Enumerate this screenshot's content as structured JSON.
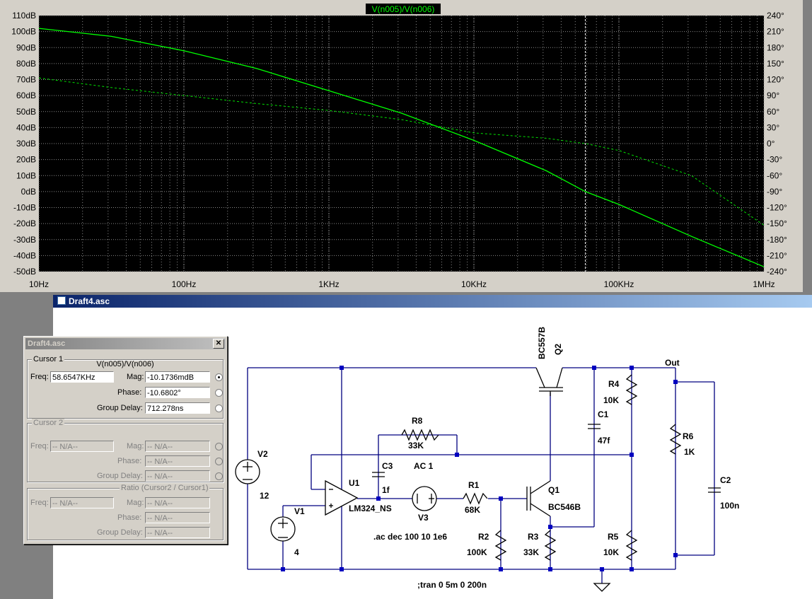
{
  "plot": {
    "trace_title": "V(n005)/V(n006)",
    "trace_color": "#00ff00",
    "y_left_labels": [
      "110dB",
      "100dB",
      "90dB",
      "80dB",
      "70dB",
      "60dB",
      "50dB",
      "40dB",
      "30dB",
      "20dB",
      "10dB",
      "0dB",
      "-10dB",
      "-20dB",
      "-30dB",
      "-40dB",
      "-50dB"
    ],
    "y_right_labels": [
      "240°",
      "210°",
      "180°",
      "150°",
      "120°",
      "90°",
      "60°",
      "30°",
      "0°",
      "-30°",
      "-60°",
      "-90°",
      "-120°",
      "-150°",
      "-180°",
      "-210°",
      "-240°"
    ],
    "x_labels": [
      "10Hz",
      "100Hz",
      "1KHz",
      "10KHz",
      "100KHz",
      "1MHz"
    ],
    "y_range_db": [
      -50,
      110
    ],
    "y_range_deg": [
      -240,
      240
    ],
    "x_range_hz": [
      10,
      1000000
    ],
    "x_scale": "log",
    "cursor_freq_hz": 58654.7,
    "magnitude_db": [
      [
        10,
        102
      ],
      [
        31.6,
        97
      ],
      [
        100,
        88
      ],
      [
        316,
        77
      ],
      [
        1000,
        63
      ],
      [
        3162,
        49
      ],
      [
        10000,
        32
      ],
      [
        31623,
        13
      ],
      [
        58655,
        0
      ],
      [
        100000,
        -8
      ],
      [
        316228,
        -28
      ],
      [
        1000000,
        -47
      ]
    ],
    "phase_deg": [
      [
        10,
        123
      ],
      [
        31.6,
        105
      ],
      [
        100,
        90
      ],
      [
        316,
        75
      ],
      [
        1000,
        62
      ],
      [
        3162,
        45
      ],
      [
        10000,
        20
      ],
      [
        31623,
        10
      ],
      [
        58655,
        0
      ],
      [
        100000,
        -13
      ],
      [
        316228,
        -60
      ],
      [
        1000000,
        -153
      ]
    ]
  },
  "schematic_window": {
    "title": "Draft4.asc"
  },
  "schematic": {
    "labels": {
      "q2_model": "BC557B",
      "q2": "Q2",
      "out": "Out",
      "r4": "R4",
      "r4_val": "10K",
      "c1": "C1",
      "c1_val": "47f",
      "r8": "R8",
      "r8_val": "33K",
      "r6": "R6",
      "r6_val": "1K",
      "v2": "V2",
      "v2_val": "12",
      "c3": "C3",
      "c3_val": "1f",
      "ac": "AC 1",
      "u1": "U1",
      "u1_model": "LM324_NS",
      "v3": "V3",
      "r1": "R1",
      "r1_val": "68K",
      "q1": "Q1",
      "q1_model": "BC546B",
      "c2": "C2",
      "c2_val": "100n",
      "v1": "V1",
      "v1_val": "4",
      "r2": "R2",
      "r2_val": "100K",
      "r3": "R3",
      "r3_val": "33K",
      "r5": "R5",
      "r5_val": "10K",
      "ac_cmd": ".ac dec 100 10 1e6",
      "tran_cmd": ";tran 0 5m 0 200n"
    }
  },
  "cursor_dialog": {
    "title": "Draft4.asc",
    "cursor1": {
      "legend": "Cursor 1",
      "expr": "V(n005)/V(n006)",
      "freq_label": "Freq:",
      "freq": "58.6547KHz",
      "mag_label": "Mag:",
      "mag": "-10.1736mdB",
      "phase_label": "Phase:",
      "phase": "-10.6802°",
      "gd_label": "Group Delay:",
      "gd": "712.278ns"
    },
    "cursor2": {
      "legend": "Cursor 2",
      "freq_label": "Freq:",
      "freq": "-- N/A--",
      "mag_label": "Mag:",
      "mag": "-- N/A--",
      "phase_label": "Phase:",
      "phase": "-- N/A--",
      "gd_label": "Group Delay:",
      "gd": "-- N/A--"
    },
    "ratio": {
      "legend": "Ratio (Cursor2 / Cursor1)",
      "freq_label": "Freq:",
      "freq": "-- N/A--",
      "mag_label": "Mag:",
      "mag": "-- N/A--",
      "phase_label": "Phase:",
      "phase": "-- N/A--",
      "gd_label": "Group Delay:",
      "gd": "-- N/A--"
    }
  }
}
